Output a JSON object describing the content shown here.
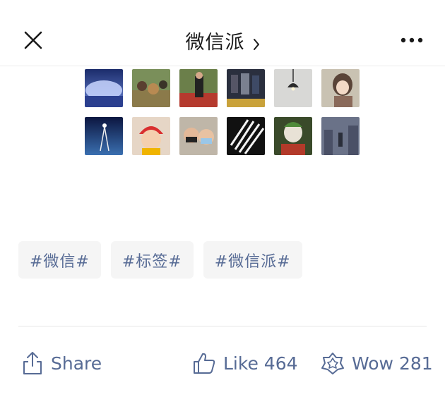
{
  "header": {
    "title": "微信派",
    "close_icon": "close-icon",
    "more_icon": "more-icon",
    "chevron_icon": "chevron-right-icon"
  },
  "thumbnails": {
    "rows": [
      [
        "moon-night-scene",
        "animals-outdoors",
        "person-in-red-garden",
        "movie-poster-crowd",
        "pendant-lamp",
        "anime-girl"
      ],
      [
        "night-sky-figure",
        "child-red-hat",
        "two-kids-masks",
        "black-white-stripes",
        "joker-clown",
        "anime-street-scene"
      ]
    ]
  },
  "tags": [
    "#微信#",
    "#标签#",
    "#微信派#"
  ],
  "actions": {
    "share_label": "Share",
    "like_label": "Like 464",
    "wow_label": "Wow 281"
  },
  "colors": {
    "link": "#576b95",
    "tag_bg": "#f5f5f5",
    "title": "#1a1a1a"
  }
}
